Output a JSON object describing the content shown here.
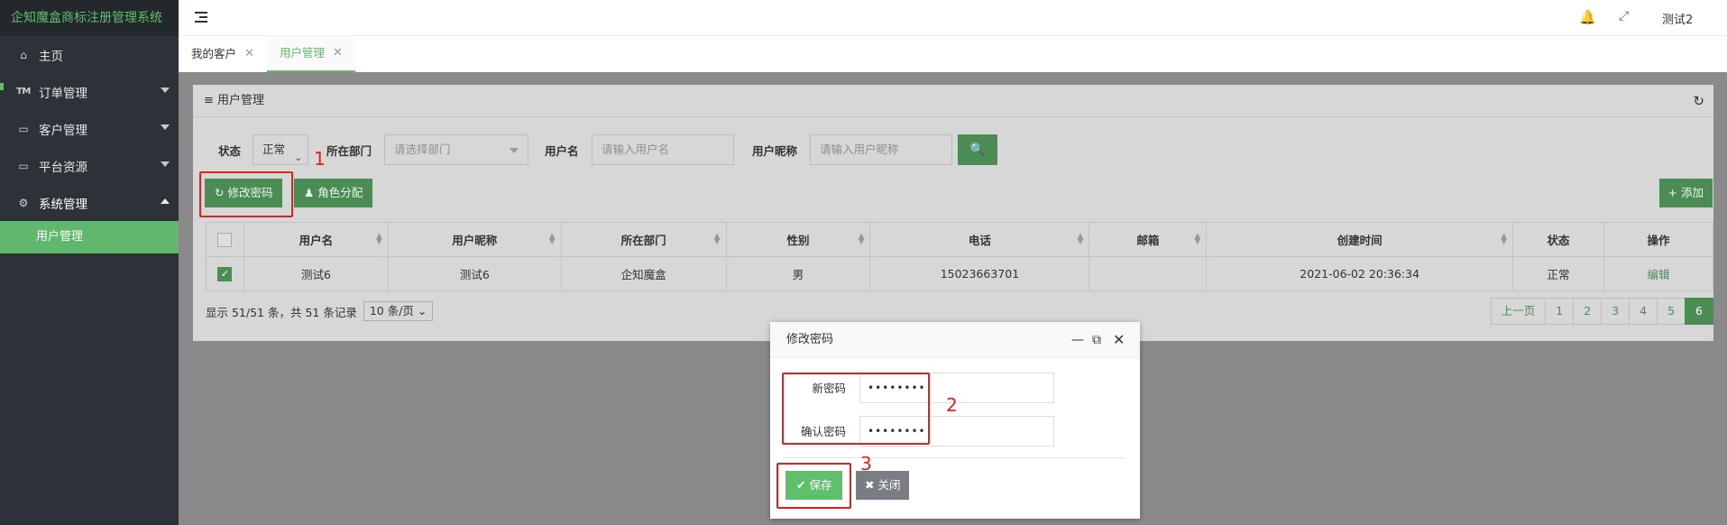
{
  "app": {
    "title": "企知魔盒商标注册管理系统"
  },
  "sidebar": {
    "items": [
      {
        "label": "主页",
        "icon": "home-icon"
      },
      {
        "label": "订单管理",
        "icon": "tm-icon"
      },
      {
        "label": "客户管理",
        "icon": "monitor-icon"
      },
      {
        "label": "平台资源",
        "icon": "monitor-icon"
      },
      {
        "label": "系统管理",
        "icon": "gear-icon"
      }
    ],
    "sub_active": "用户管理"
  },
  "topbar": {
    "user": "测试2"
  },
  "tabs": [
    {
      "label": "我的客户",
      "active": false
    },
    {
      "label": "用户管理",
      "active": true
    }
  ],
  "panel": {
    "title": "用户管理",
    "filter": {
      "status_label": "状态",
      "status_value": "正常",
      "dept_label": "所在部门",
      "dept_placeholder": "请选择部门",
      "username_label": "用户名",
      "username_placeholder": "请输入用户名",
      "nickname_label": "用户昵称",
      "nickname_placeholder": "请输入用户昵称"
    },
    "toolbar": {
      "change_password": "修改密码",
      "assign_role": "角色分配",
      "add": "添加"
    },
    "table": {
      "columns": [
        "用户名",
        "用户昵称",
        "所在部门",
        "性别",
        "电话",
        "邮箱",
        "创建时间",
        "状态",
        "操作"
      ],
      "rows": [
        {
          "username": "测试6",
          "nickname": "测试6",
          "dept": "企知魔盒",
          "gender": "男",
          "phone": "15023663701",
          "email": "",
          "created": "2021-06-02 20:36:34",
          "status": "正常",
          "action": "编辑",
          "checked": true
        }
      ]
    },
    "pagination": {
      "info": "显示 51/51 条，共 51 条记录",
      "page_size": "10 条/页",
      "prev": "上一页",
      "pages": [
        "1",
        "2",
        "3",
        "4",
        "5",
        "6"
      ],
      "current": "6"
    }
  },
  "modal": {
    "title": "修改密码",
    "new_password_label": "新密码",
    "new_password_value": "••••••••",
    "confirm_password_label": "确认密码",
    "confirm_password_value": "••••••••",
    "save": "保存",
    "close": "关闭"
  },
  "annotations": {
    "step1": "1",
    "step2": "2",
    "step3": "3",
    "color": "#e0211e"
  },
  "colors": {
    "accent": "#5fbf6c",
    "sidebar_bg": "#2c3238"
  }
}
